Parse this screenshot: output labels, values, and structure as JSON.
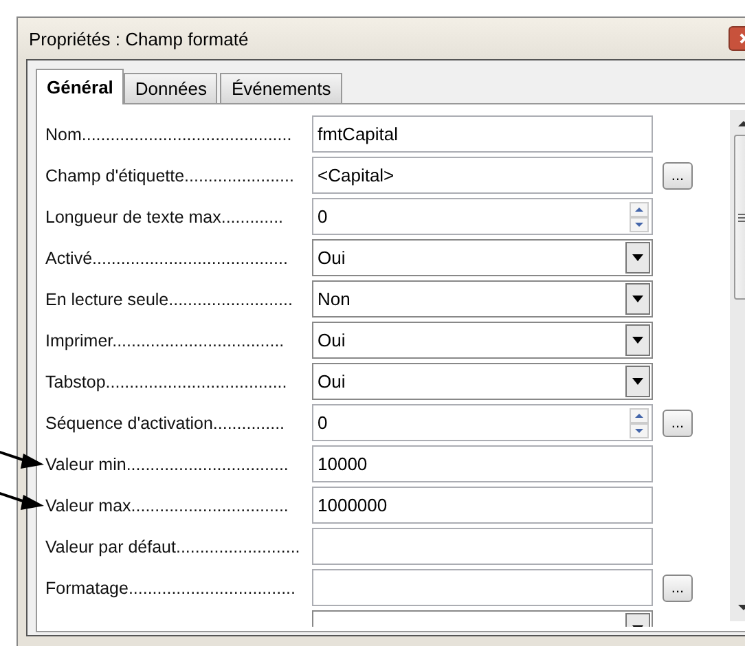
{
  "window": {
    "title": "Propriétés : Champ formaté"
  },
  "tabs": [
    {
      "label": "Général",
      "selected": true
    },
    {
      "label": "Données",
      "selected": false
    },
    {
      "label": "Événements",
      "selected": false
    }
  ],
  "rows": [
    {
      "kind": "text",
      "label": "Nom............................................",
      "value": "fmtCapital"
    },
    {
      "kind": "text",
      "label": "Champ d'étiquette.......................",
      "value": "<Capital>",
      "more_button": "..."
    },
    {
      "kind": "spin",
      "label": "Longueur de texte max.............",
      "value": "0"
    },
    {
      "kind": "select",
      "label": "Activé.........................................",
      "value": "Oui"
    },
    {
      "kind": "select",
      "label": "En lecture seule..........................",
      "value": "Non"
    },
    {
      "kind": "select",
      "label": "Imprimer....................................",
      "value": "Oui"
    },
    {
      "kind": "select",
      "label": "Tabstop......................................",
      "value": "Oui"
    },
    {
      "kind": "spin",
      "label": "Séquence d'activation...............",
      "value": "0",
      "more_button": "..."
    },
    {
      "kind": "text",
      "label": "Valeur min..................................",
      "value": "10000",
      "pointer_arrow": true
    },
    {
      "kind": "text",
      "label": "Valeur max.................................",
      "value": "1000000",
      "pointer_arrow": true
    },
    {
      "kind": "text",
      "label": "Valeur par défaut.........................."
    },
    {
      "kind": "text",
      "label": "Formatage...................................",
      "more_button": "..."
    },
    {
      "kind": "select"
    }
  ]
}
